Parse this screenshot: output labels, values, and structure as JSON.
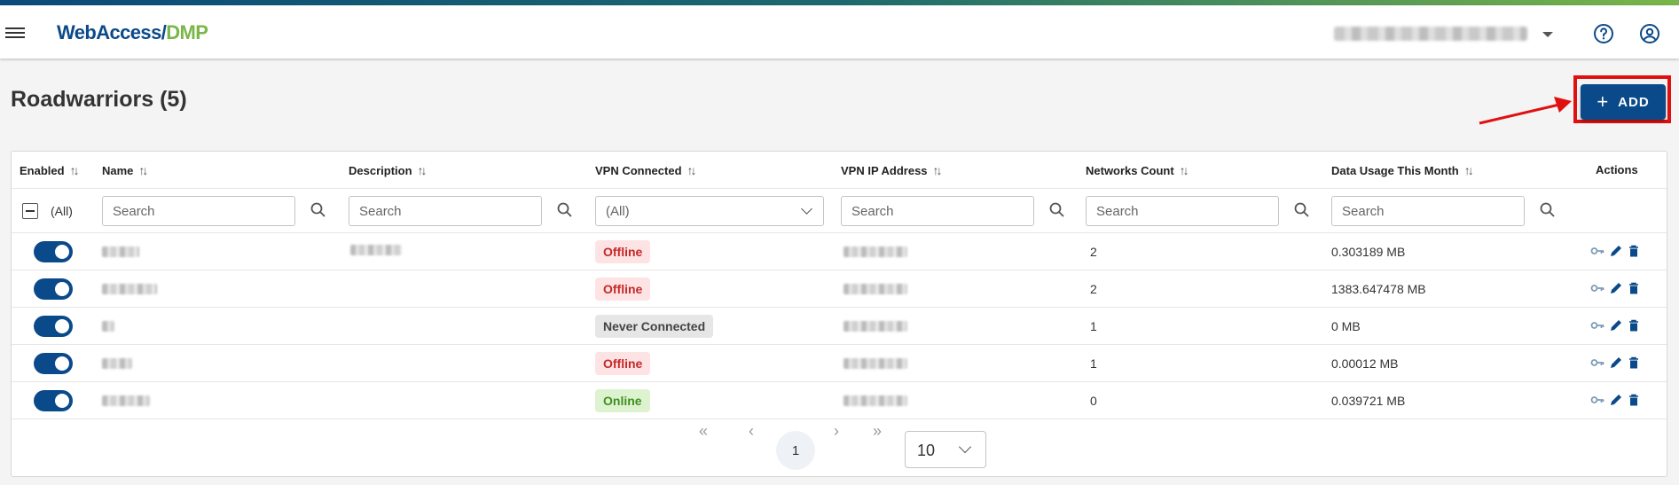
{
  "app": {
    "logo_part1": "WebAccess/",
    "logo_part2": "DMP"
  },
  "page": {
    "title": "Roadwarriors (5)",
    "add_button": "ADD"
  },
  "table": {
    "columns": [
      "Enabled",
      "Name",
      "Description",
      "VPN Connected",
      "VPN IP Address",
      "Networks Count",
      "Data Usage This Month",
      "Actions"
    ],
    "filters": {
      "enabled": "(All)",
      "search_placeholder": "Search",
      "vpn_connected": "(All)"
    },
    "rows": [
      {
        "status": "Offline",
        "networks_count": "2",
        "data_usage": "0.303189 MB"
      },
      {
        "status": "Offline",
        "networks_count": "2",
        "data_usage": "1383.647478 MB"
      },
      {
        "status": "Never Connected",
        "networks_count": "1",
        "data_usage": "0 MB"
      },
      {
        "status": "Offline",
        "networks_count": "1",
        "data_usage": "0.00012 MB"
      },
      {
        "status": "Online",
        "networks_count": "0",
        "data_usage": "0.039721 MB"
      }
    ]
  },
  "pagination": {
    "current_page": "1",
    "page_size": "10",
    "first": "«",
    "prev": "‹",
    "next": "›",
    "last": "»"
  },
  "colors": {
    "brand_blue": "#0b4a8a",
    "brand_green": "#7ab648",
    "highlight": "#e01010",
    "offline": "#c62828",
    "online": "#3f8f22"
  },
  "icons": [
    "menu-icon",
    "help-icon",
    "account-icon",
    "sort-icon",
    "search-icon",
    "key-icon",
    "edit-icon",
    "delete-icon"
  ]
}
